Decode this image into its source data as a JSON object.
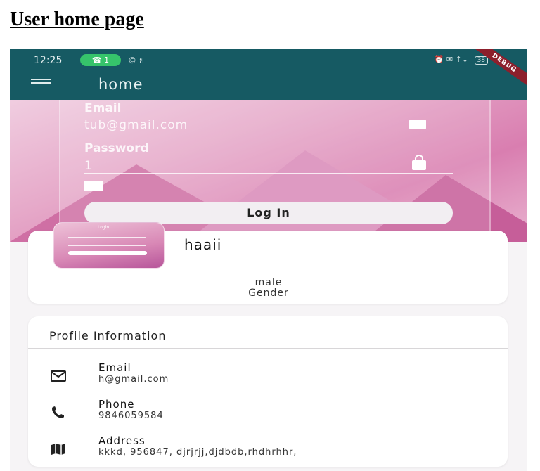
{
  "document": {
    "heading": "User home page"
  },
  "status_bar": {
    "time": "12:25",
    "pill": "1",
    "extra": "© ย",
    "right": "⏰ ✉ ↑↓",
    "battery": "38",
    "ribbon": "DEBUG"
  },
  "appbar": {
    "title": "home"
  },
  "login_preview": {
    "email_label": "Email",
    "email_value": "tub@gmail.com",
    "password_label": "Password",
    "password_value": "1",
    "button_label": "Log In",
    "mini_title": "Login"
  },
  "profile": {
    "name": "haaii",
    "gender_value": "male",
    "gender_label": "Gender"
  },
  "info": {
    "header": "Profile Information",
    "rows": [
      {
        "label": "Email",
        "value": "h@gmail.com",
        "icon": "mail-icon"
      },
      {
        "label": "Phone",
        "value": "9846059584",
        "icon": "phone-icon"
      },
      {
        "label": "Address",
        "value": "kkkd, 956847, djrjrjj,djdbdb,rhdhrhhr,",
        "icon": "map-icon"
      }
    ]
  },
  "colors": {
    "appbar": "#165a63",
    "accent_pink": "#d97eb0",
    "card": "#ffffff"
  }
}
